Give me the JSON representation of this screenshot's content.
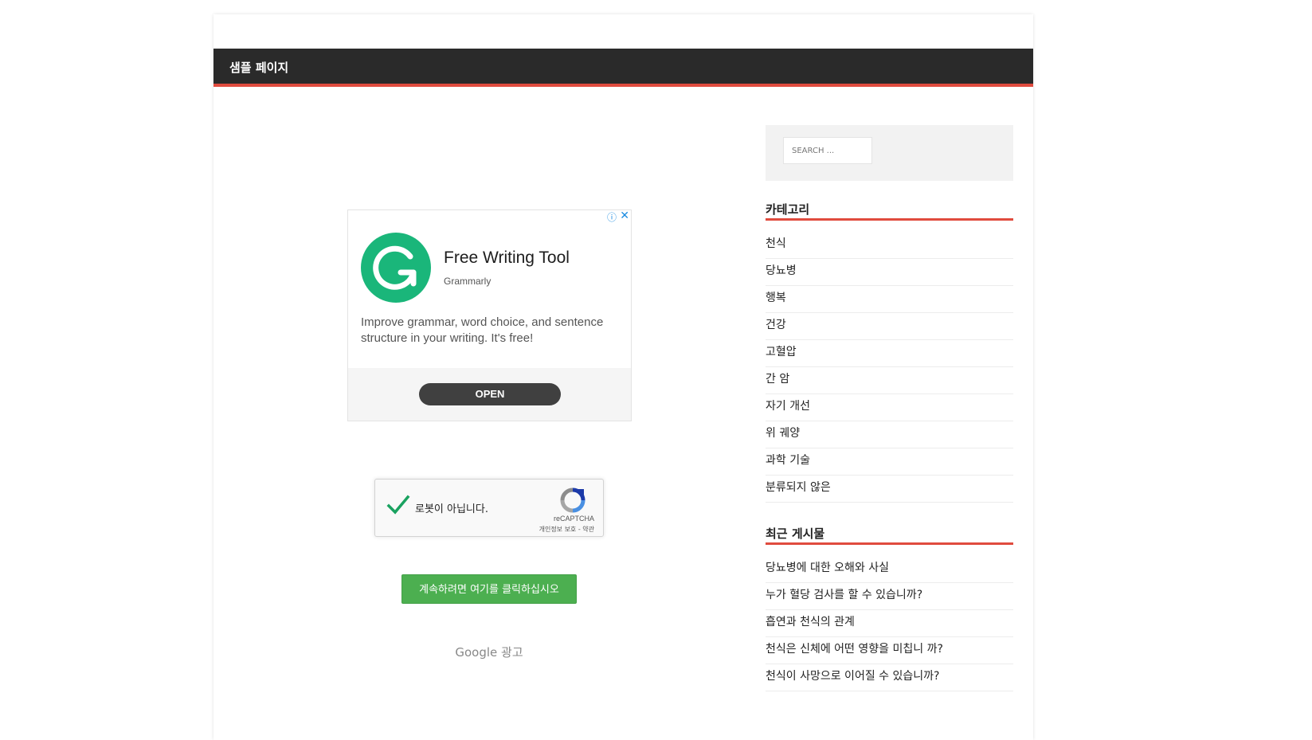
{
  "site": {
    "title": "샘플 페이지"
  },
  "ad": {
    "adchoices_icon": "info-icon",
    "close_icon": "close-icon",
    "logo_icon": "grammarly-logo",
    "headline": "Free Writing Tool",
    "advertiser": "Grammarly",
    "body": "Improve grammar, word choice, and sentence structure in your writing. It's free!",
    "cta": "OPEN",
    "brand_color": "#1ab67a"
  },
  "recaptcha": {
    "label": "로봇이 아닙니다.",
    "brand": "reCAPTCHA",
    "links": "개인정보 보호 - 약관",
    "check_color": "#1aa260"
  },
  "continue_button": "계속하려면 여기를 클릭하십시오",
  "google_ad_label": "Google 광고",
  "sidebar": {
    "search_placeholder": "SEARCH ...",
    "categories_title": "카테고리",
    "categories": [
      "천식",
      "당뇨병",
      "행복",
      "건강",
      "고혈압",
      "간 암",
      "자기 개선",
      "위 궤양",
      "과학 기술",
      "분류되지 않은"
    ],
    "recent_title": "최근 게시물",
    "recent_posts": [
      "당뇨병에 대한 오해와 사실",
      "누가 혈당 검사를 할 수 있습니까?",
      "흡연과 천식의 관계",
      "천식은 신체에 어떤 영향을 미칩니 까?",
      "천식이 사망으로 이어질 수 있습니까?"
    ],
    "accent_color": "#e04b3e"
  }
}
